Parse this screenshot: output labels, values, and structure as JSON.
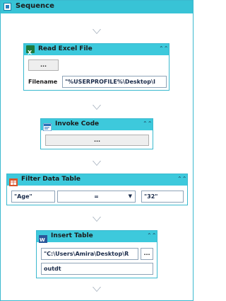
{
  "sequence": {
    "title": "Sequence"
  },
  "activities": {
    "read_excel": {
      "title": "Read Excel File",
      "browse_label": "...",
      "filename_label": "Filename",
      "filename_value": "\"%USERPROFILE%\\Desktop\\I"
    },
    "invoke_code": {
      "title": "Invoke Code",
      "edit_label": "..."
    },
    "filter_table": {
      "title": "Filter Data Table",
      "column_value": "\"Age\"",
      "operator_value": "=",
      "compare_value": "\"32\""
    },
    "insert_table": {
      "title": "Insert Table",
      "path_value": "\"C:\\Users\\Amira\\Desktop\\R",
      "browse_label": "...",
      "table_value": "outdt"
    }
  },
  "colors": {
    "header": "#3dc9dc",
    "border": "#3bb9cf",
    "excel_icon": "#1e7a3c",
    "code_icon": "#2a6fb8",
    "filter_icon": "#d9542b",
    "word_icon": "#2b579a"
  },
  "icons": {
    "collapse": "double-chevron-up-icon",
    "dropdown": "caret-down-icon"
  }
}
